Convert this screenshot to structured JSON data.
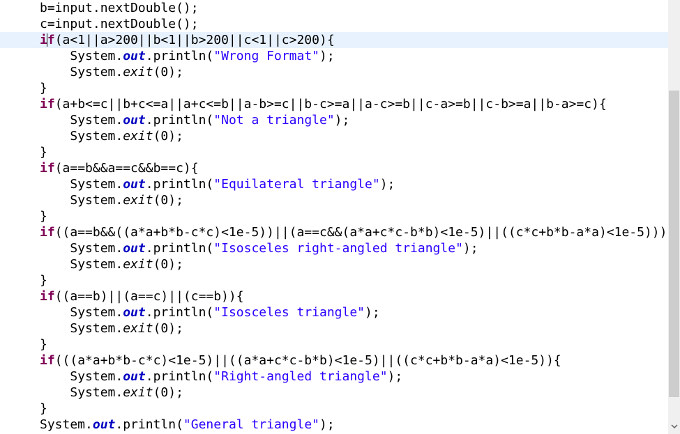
{
  "editor": {
    "lines": [
      {
        "indent": "",
        "parts": [
          [
            "plain",
            "b=input.nextDouble();"
          ]
        ]
      },
      {
        "indent": "",
        "parts": [
          [
            "plain",
            "c=input.nextDouble();"
          ]
        ]
      },
      {
        "indent": "",
        "current": true,
        "parts": [
          [
            "kw",
            "if"
          ],
          [
            "plain",
            "(a<1||a>200||b<1||b>200||c<1||c>200){"
          ]
        ]
      },
      {
        "indent": "    ",
        "parts": [
          [
            "plain",
            "System."
          ],
          [
            "field",
            "out"
          ],
          [
            "plain",
            ".println("
          ],
          [
            "str",
            "\"Wrong Format\""
          ],
          [
            "plain",
            ");"
          ]
        ]
      },
      {
        "indent": "    ",
        "parts": [
          [
            "plain",
            "System."
          ],
          [
            "method-static",
            "exit"
          ],
          [
            "plain",
            "(0);"
          ]
        ]
      },
      {
        "indent": "",
        "parts": [
          [
            "plain",
            "}"
          ]
        ]
      },
      {
        "indent": "",
        "parts": [
          [
            "kw",
            "if"
          ],
          [
            "plain",
            "(a+b<=c||b+c<=a||a+c<=b||a-b>=c||b-c>=a||a-c>=b||c-a>=b||c-b>=a||b-a>=c){"
          ]
        ]
      },
      {
        "indent": "    ",
        "parts": [
          [
            "plain",
            "System."
          ],
          [
            "field",
            "out"
          ],
          [
            "plain",
            ".println("
          ],
          [
            "str",
            "\"Not a triangle\""
          ],
          [
            "plain",
            ");"
          ]
        ]
      },
      {
        "indent": "    ",
        "parts": [
          [
            "plain",
            "System."
          ],
          [
            "method-static",
            "exit"
          ],
          [
            "plain",
            "(0);"
          ]
        ]
      },
      {
        "indent": "",
        "parts": [
          [
            "plain",
            "}"
          ]
        ]
      },
      {
        "indent": "",
        "parts": [
          [
            "kw",
            "if"
          ],
          [
            "plain",
            "(a==b&&a==c&&b==c){"
          ]
        ]
      },
      {
        "indent": "    ",
        "parts": [
          [
            "plain",
            "System."
          ],
          [
            "field",
            "out"
          ],
          [
            "plain",
            ".println("
          ],
          [
            "str",
            "\"Equilateral triangle\""
          ],
          [
            "plain",
            ");"
          ]
        ]
      },
      {
        "indent": "    ",
        "parts": [
          [
            "plain",
            "System."
          ],
          [
            "method-static",
            "exit"
          ],
          [
            "plain",
            "(0);"
          ]
        ]
      },
      {
        "indent": "",
        "parts": [
          [
            "plain",
            "}"
          ]
        ]
      },
      {
        "indent": "",
        "parts": [
          [
            "kw",
            "if"
          ],
          [
            "plain",
            "((a==b&&((a*a+b*b-c*c)<1e-5))||(a==c&&(a*a+c*c-b*b)<1e-5)||((c*c+b*b-a*a)<1e-5)))"
          ]
        ]
      },
      {
        "indent": "    ",
        "parts": [
          [
            "plain",
            "System."
          ],
          [
            "field",
            "out"
          ],
          [
            "plain",
            ".println("
          ],
          [
            "str",
            "\"Isosceles right-angled triangle\""
          ],
          [
            "plain",
            ");"
          ]
        ]
      },
      {
        "indent": "    ",
        "parts": [
          [
            "plain",
            "System."
          ],
          [
            "method-static",
            "exit"
          ],
          [
            "plain",
            "(0);"
          ]
        ]
      },
      {
        "indent": "",
        "parts": [
          [
            "plain",
            "}"
          ]
        ]
      },
      {
        "indent": "",
        "parts": [
          [
            "kw",
            "if"
          ],
          [
            "plain",
            "((a==b)||(a==c)||(c==b)){"
          ]
        ]
      },
      {
        "indent": "    ",
        "parts": [
          [
            "plain",
            "System."
          ],
          [
            "field",
            "out"
          ],
          [
            "plain",
            ".println("
          ],
          [
            "str",
            "\"Isosceles triangle\""
          ],
          [
            "plain",
            ");"
          ]
        ]
      },
      {
        "indent": "    ",
        "parts": [
          [
            "plain",
            "System."
          ],
          [
            "method-static",
            "exit"
          ],
          [
            "plain",
            "(0);"
          ]
        ]
      },
      {
        "indent": "",
        "parts": [
          [
            "plain",
            "}"
          ]
        ]
      },
      {
        "indent": "",
        "parts": [
          [
            "kw",
            "if"
          ],
          [
            "plain",
            "(((a*a+b*b-c*c)<1e-5)||((a*a+c*c-b*b)<1e-5)||((c*c+b*b-a*a)<1e-5)){"
          ]
        ]
      },
      {
        "indent": "    ",
        "parts": [
          [
            "plain",
            "System."
          ],
          [
            "field",
            "out"
          ],
          [
            "plain",
            ".println("
          ],
          [
            "str",
            "\"Right-angled triangle\""
          ],
          [
            "plain",
            ");"
          ]
        ]
      },
      {
        "indent": "    ",
        "parts": [
          [
            "plain",
            "System."
          ],
          [
            "method-static",
            "exit"
          ],
          [
            "plain",
            "(0);"
          ]
        ]
      },
      {
        "indent": "",
        "parts": [
          [
            "plain",
            "}"
          ]
        ]
      },
      {
        "indent": "",
        "parts": [
          [
            "plain",
            "System."
          ],
          [
            "field",
            "out"
          ],
          [
            "plain",
            ".println("
          ],
          [
            "str",
            "\"General triangle\""
          ],
          [
            "plain",
            ");"
          ]
        ]
      }
    ]
  },
  "scrollbar": {
    "down_arrow_icon": "chevron-down-icon"
  },
  "colors": {
    "keyword": "#7f0055",
    "field": "#0000c0",
    "string": "#2a00ff",
    "current_line": "#e8f2fe"
  }
}
